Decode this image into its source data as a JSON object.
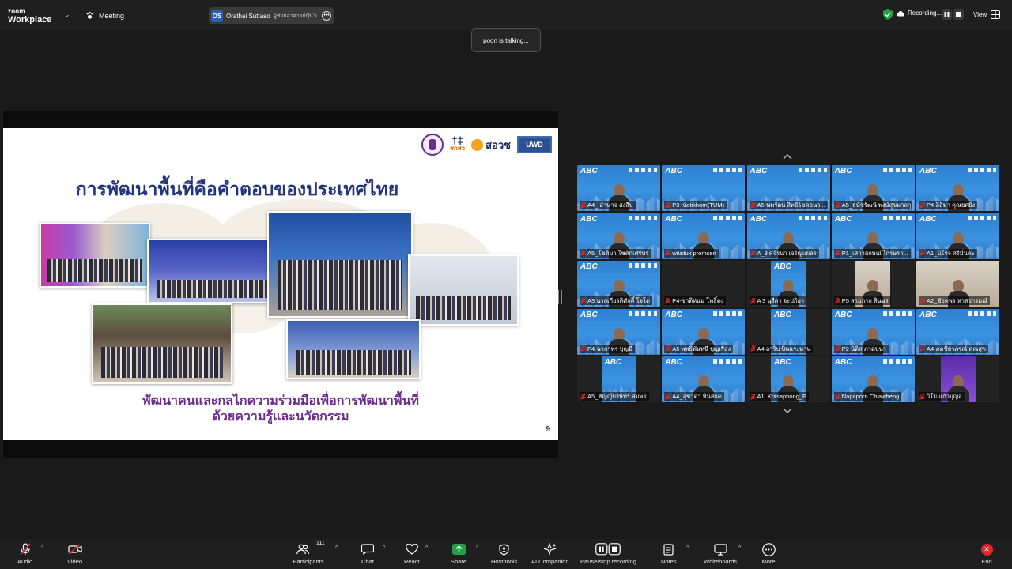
{
  "app": {
    "brand_line1": "zoom",
    "brand_line2": "Workplace",
    "meeting_label": "Meeting"
  },
  "host": {
    "initials": "OS",
    "name": "Orathai Suttaso",
    "role": "ผู้ช่วยอาจารย์บุ๊น'ร"
  },
  "status": {
    "recording_label": "Recording...",
    "view_label": "View"
  },
  "speaker_toast": "poon is talking...",
  "slide": {
    "title": "การพัฒนาพื้นที่คือคำตอบของประเทศไทย",
    "subtitle_line1": "พัฒนาคนและกลไกความร่วมมือเพื่อการพัฒนาพื้นที่",
    "subtitle_line2": "ด้วยความรู้และนวัตกรรม",
    "page_number": "9",
    "logos": {
      "sksv_text": "สกสว",
      "sorov_text": "สอวช",
      "uwd_text": "UWD"
    }
  },
  "participants": [
    {
      "name": "A4_ อำนาจ สงสีบ",
      "bg": "abc",
      "person": true
    },
    {
      "name": "P3 Kiatikhorn(TUM)",
      "bg": "abc",
      "person": false
    },
    {
      "name": "A5-นพรัตน์ สิทธิโชคธนา...",
      "bg": "abc",
      "person": false
    },
    {
      "name": "A5_ธนัชรัฒน์ พงษ์สุขมาลกุล",
      "bg": "abc",
      "person": true
    },
    {
      "name": "P4-อิสิมา คุณยศยิ่ง",
      "bg": "abc",
      "person": true
    },
    {
      "name": "A5_โชติมา โชติกเศรีบร",
      "bg": "abc",
      "person": true
    },
    {
      "name": "wilailux promsen",
      "bg": "abc",
      "person": true
    },
    {
      "name": "A_3 ศจิรนา เจริญแผลร",
      "bg": "abc",
      "person": true
    },
    {
      "name": "P1_เสาวลักษณ์ ไกรษรา...",
      "bg": "abc",
      "person": true
    },
    {
      "name": "A1_นิโรจ ศรีมั่นดะ",
      "bg": "abc",
      "person": true
    },
    {
      "name": "A3 นายเกียรติศักดิ์ โจโด",
      "bg": "abc",
      "person": true
    },
    {
      "name": "P4-ชาติหนม โพธิ์คง",
      "bg": "dark",
      "person": false
    },
    {
      "name": "A 3 นุรีดา จะปกิยา",
      "bg": "abc-narrow",
      "person": true
    },
    {
      "name": "P5 สามกรก สินนร",
      "bg": "room-narrow",
      "person": true
    },
    {
      "name": "A2_ชัยตพร หาสอารมณ์",
      "bg": "room",
      "person": true
    },
    {
      "name": "P4-ฉากาพร บุญมี",
      "bg": "abc",
      "person": true
    },
    {
      "name": "A5 พทธิพันทนี บุญเรือง",
      "bg": "abc",
      "person": true
    },
    {
      "name": "A4 อาริบ บินแระหาน",
      "bg": "abc-narrow",
      "person": false
    },
    {
      "name": "P2 นิติศ ภาดบุนา",
      "bg": "abc",
      "person": true
    },
    {
      "name": "A4-ภคชิยาภรณ์ คุณสุข",
      "bg": "abc",
      "person": false
    },
    {
      "name": "A5_ชัญญ์บริษัทร์ สมพร",
      "bg": "abc-narrow",
      "person": false
    },
    {
      "name": "A4_สุชาดา หินสกด",
      "bg": "abc",
      "person": true
    },
    {
      "name": "A1. Kritsaphong_P",
      "bg": "abc-narrow",
      "person": true
    },
    {
      "name": "Napaporn Chiawheng",
      "bg": "abc",
      "person": true
    },
    {
      "name": "วิโม แก้วบุญล",
      "bg": "purple-narrow",
      "person": true
    }
  ],
  "toolbar": {
    "audio": "Audio",
    "video": "Video",
    "participants": "Participants",
    "participant_count": "111",
    "chat": "Chat",
    "react": "React",
    "share": "Share",
    "host_tools": "Host tools",
    "ai_companion": "AI Companion",
    "pause_recording": "Pause/stop recording",
    "notes": "Notes",
    "whiteboards": "Whiteboards",
    "more": "More",
    "end": "End"
  },
  "colors": {
    "recording_green": "#24a148",
    "end_red": "#e02828",
    "slide_title": "#23357b",
    "slide_subtitle": "#6b2c91",
    "tile_blue": "#3b94e2"
  }
}
